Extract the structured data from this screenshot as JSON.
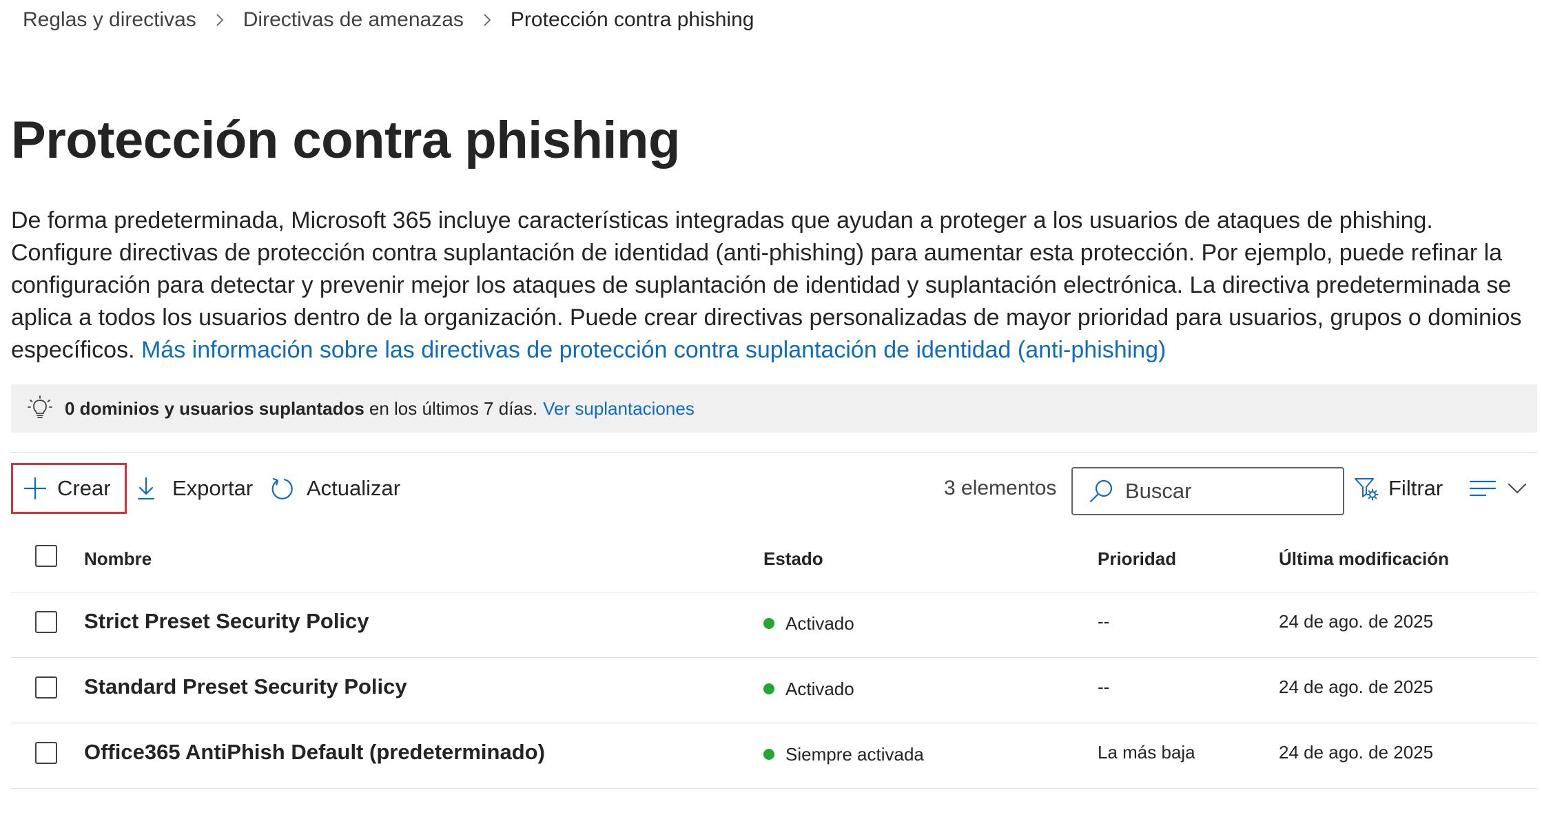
{
  "breadcrumb": {
    "items": [
      "Reglas y directivas",
      "Directivas de amenazas",
      "Protección contra phishing"
    ]
  },
  "page": {
    "title": "Protección contra phishing",
    "description": "De forma predeterminada, Microsoft 365 incluye características integradas que ayudan a proteger a los usuarios de ataques de phishing. Configure directivas de protección contra suplantación de identidad (anti-phishing) para aumentar esta protección. Por ejemplo, puede refinar la configuración para detectar y prevenir mejor los ataques de suplantación de identidad y suplantación electrónica. La directiva predeterminada se aplica a todos los usuarios dentro de la organización. Puede crear directivas personalizadas de mayor prioridad para usuarios, grupos o dominios específicos.",
    "learn_more_link": "Más información sobre las directivas de protección contra suplantación de identidad (anti-phishing)"
  },
  "banner": {
    "icon": "lightbulb-icon",
    "bold_text": "0 dominios y usuarios suplantados",
    "text": "en los últimos 7 días.",
    "link": "Ver suplantaciones"
  },
  "toolbar": {
    "create_label": "Crear",
    "export_label": "Exportar",
    "refresh_label": "Actualizar",
    "item_count": "3 elementos",
    "search_placeholder": "Buscar",
    "filter_label": "Filtrar"
  },
  "table": {
    "columns": {
      "name": "Nombre",
      "status": "Estado",
      "priority": "Prioridad",
      "modified": "Última modificación"
    },
    "rows": [
      {
        "name": "Strict Preset Security Policy",
        "status": "Activado",
        "priority": "--",
        "modified": "24 de ago. de 2025"
      },
      {
        "name": "Standard Preset Security Policy",
        "status": "Activado",
        "priority": "--",
        "modified": "24 de ago. de 2025"
      },
      {
        "name": "Office365 AntiPhish Default (predeterminado)",
        "status": "Siempre activada",
        "priority": "La más baja",
        "modified": "24 de ago. de 2025"
      }
    ]
  },
  "colors": {
    "accent": "#0f6cbd",
    "highlight_border": "#d13438",
    "status_on": "#22a831",
    "banner_bg": "#f0f0f0"
  }
}
